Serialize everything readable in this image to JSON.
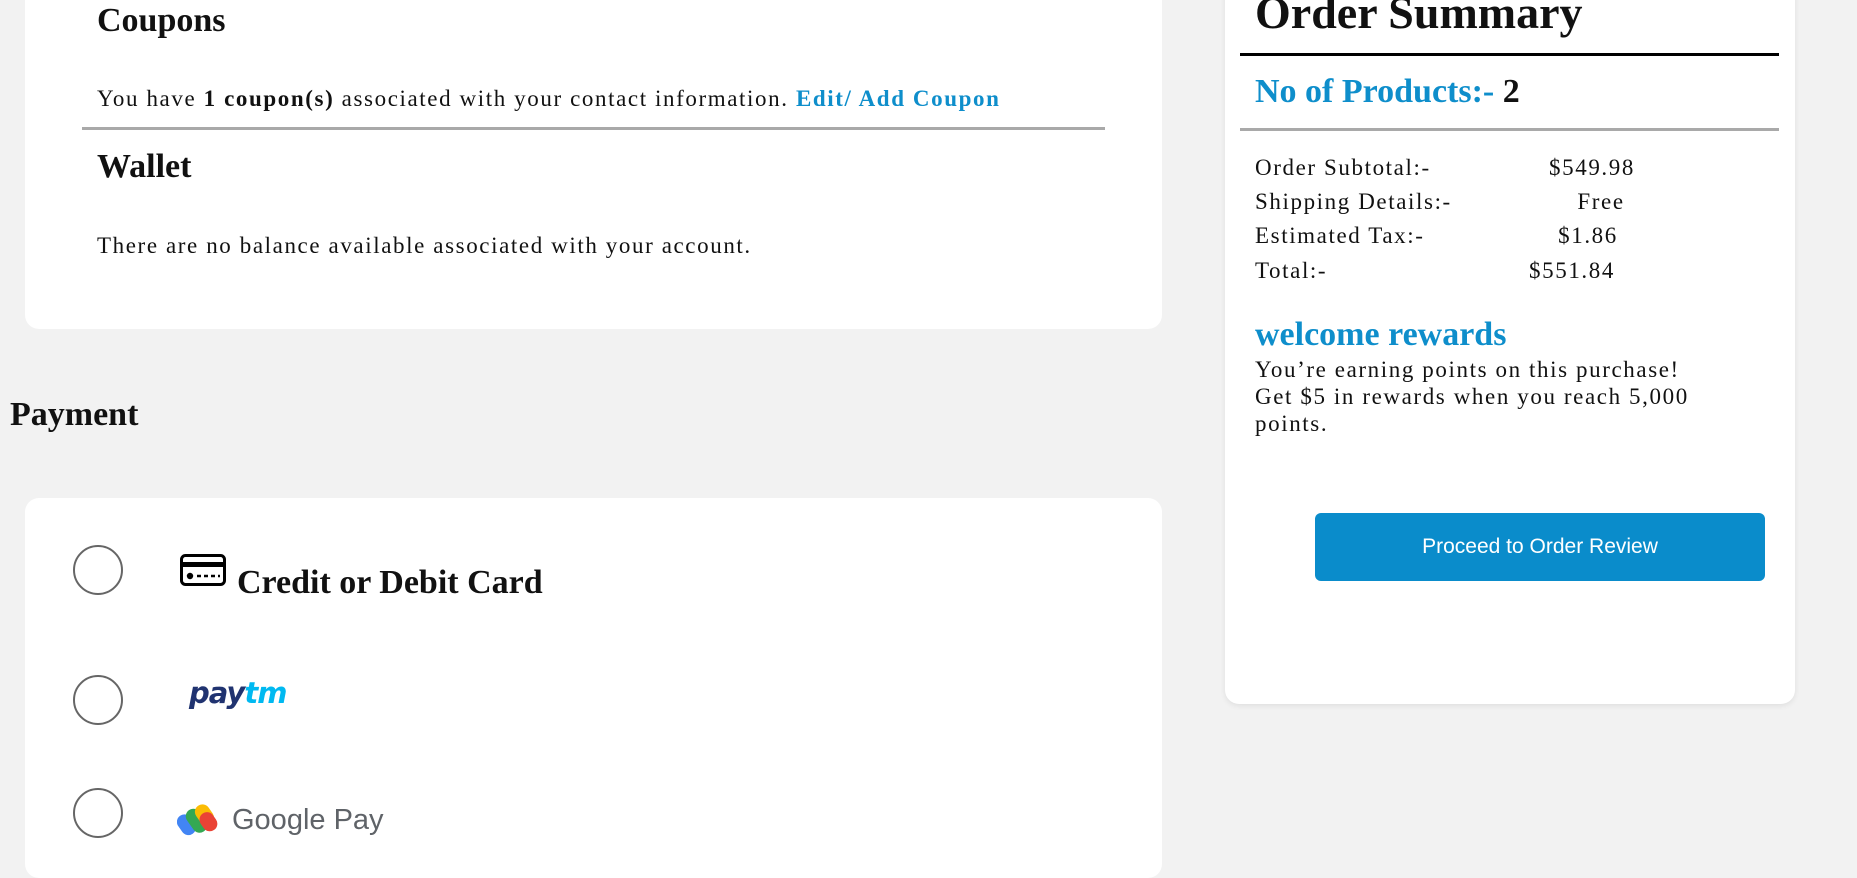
{
  "coupons": {
    "title": "Coupons",
    "text_before": "You have ",
    "count_text": "1 coupon(s)",
    "text_after": " associated with your contact information. ",
    "edit_link": "Edit/ Add Coupon"
  },
  "wallet": {
    "title": "Wallet",
    "message": "There are no balance available associated with your account."
  },
  "payment": {
    "title": "Payment",
    "options": [
      {
        "label": "Credit or Debit Card",
        "icon": "credit-card-icon"
      },
      {
        "label": "paytm",
        "icon": "paytm-logo"
      },
      {
        "label": "Google Pay",
        "icon": "google-pay-logo"
      }
    ]
  },
  "summary": {
    "title": "Order Summary",
    "products_label": "No of Products:- ",
    "products_count": "2",
    "rows": [
      {
        "label": "Order Subtotal:-",
        "value": "$549.98"
      },
      {
        "label": "Shipping Details:-",
        "value": "Free"
      },
      {
        "label": "Estimated Tax:-",
        "value": "$1.86"
      },
      {
        "label": "Total:-",
        "value": "$551.84"
      }
    ],
    "rewards_title": "welcome rewards",
    "rewards_line1": "You’re earning points on this purchase!",
    "rewards_line2": "Get $5 in rewards when you reach 5,000",
    "rewards_line3": "points.",
    "proceed_label": "Proceed to Order Review"
  },
  "colors": {
    "accent": "#0e8ecb",
    "button": "#0a8ccb",
    "page_bg": "#f2f2f2"
  }
}
